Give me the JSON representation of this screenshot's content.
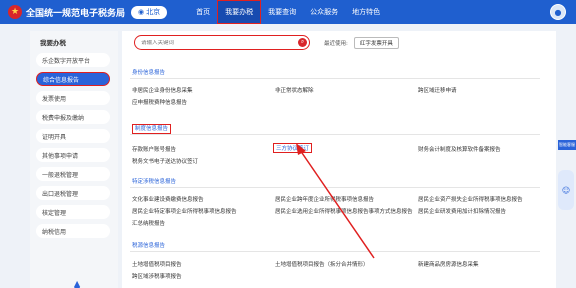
{
  "header": {
    "logo_glyph": "★",
    "title": "全国统一规范电子税务局",
    "region": "北京",
    "nav": [
      "首页",
      "我要办税",
      "我要查询",
      "公众服务",
      "地方特色"
    ]
  },
  "sidebar": {
    "title": "我要办税",
    "items": [
      "乐企数字开放平台",
      "综合信息报告",
      "发票使用",
      "税费申报及缴纳",
      "证明开具",
      "其他事项申请",
      "一般退税管理",
      "出口退税管理",
      "核定管理",
      "纳税信用"
    ]
  },
  "search": {
    "placeholder": "请输入关键词",
    "recent_label": "最近使用:",
    "recent_tag": "红字发票开具"
  },
  "sections": [
    {
      "title": "身份信息报告",
      "links": [
        "非居民企业身份信息采集",
        "非正常状态解除",
        "跨区域迁移申请",
        "应申报税费种信息报告"
      ]
    },
    {
      "title": "制度信息报告",
      "links": [
        "存款账户账号报告",
        "三方协议签订",
        "财务会计制度及核算软件备案报告",
        "税务文书电子送达协议签订"
      ]
    },
    {
      "title": "特定涉税信息报告",
      "links": [
        "文化事业建设费缴费信息报告",
        "居民企业跨年度企业所得税事项信息报告",
        "居民企业资产损失企业所得税事项信息报告",
        "居民企业特定事项企业所得税事项信息报告",
        "居民企业选用企业所得税事项信息报告事项方式信息报告",
        "居民企业研发费用加计扣除情况报告",
        "汇总纳税报告"
      ]
    },
    {
      "title": "税源信息报告",
      "links": [
        "土地增值税项目报告",
        "土地增值税项目报告（拆分合并情形）",
        "新建商品房房源信息采集",
        "跨区域涉税事项报告"
      ]
    }
  ],
  "floating": {
    "badge": "智能客服",
    "robot_icon": "☺"
  }
}
